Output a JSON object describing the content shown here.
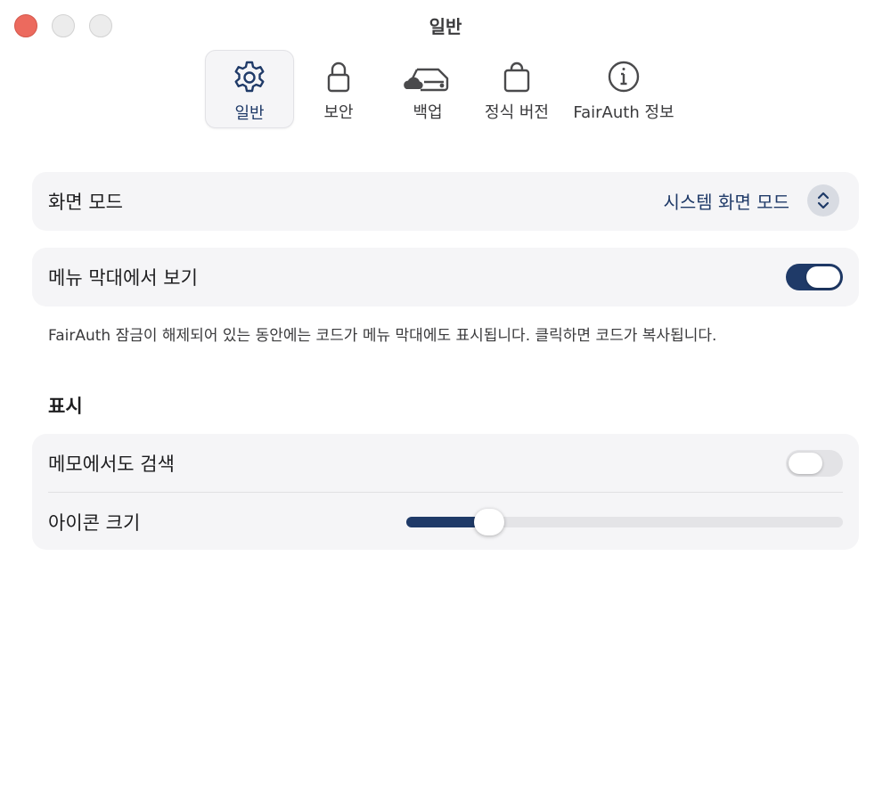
{
  "window": {
    "title": "일반"
  },
  "toolbar": {
    "items": [
      {
        "label": "일반",
        "icon": "gear-icon",
        "active": true
      },
      {
        "label": "보안",
        "icon": "lock-icon",
        "active": false
      },
      {
        "label": "백업",
        "icon": "cloud-drive-icon",
        "active": false
      },
      {
        "label": "정식 버전",
        "icon": "shopping-bag-icon",
        "active": false
      },
      {
        "label": "FairAuth 정보",
        "icon": "info-icon",
        "active": false
      }
    ]
  },
  "display_mode": {
    "label": "화면 모드",
    "value": "시스템 화면 모드",
    "icon": "chevron-up-down-icon"
  },
  "menu_bar": {
    "label": "메뉴 막대에서 보기",
    "enabled": true,
    "note": "FairAuth 잠금이 해제되어 있는 동안에는 코드가 메뉴 막대에도 표시됩니다. 클릭하면 코드가 복사됩니다."
  },
  "display_section": {
    "title": "표시",
    "search_memos": {
      "label": "메모에서도 검색",
      "enabled": false
    },
    "icon_size": {
      "label": "아이콘 크기",
      "value_fraction": 0.19
    }
  },
  "colors": {
    "accent": "#1f3a68",
    "card": "#f5f5f7",
    "close": "#ec6a5e"
  }
}
